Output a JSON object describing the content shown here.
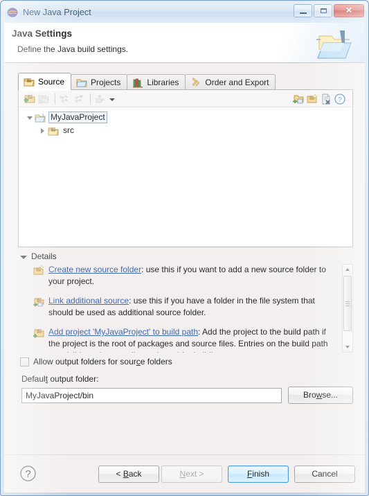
{
  "window": {
    "title": "New Java Project",
    "logo_icon": "eclipse-logo-icon",
    "controls": {
      "minimize": "minimize-icon",
      "maximize": "maximize-icon",
      "close": "✕"
    }
  },
  "banner": {
    "title": "Java Settings",
    "subtitle": "Define the Java build settings.",
    "icon": "java-project-folder-icon"
  },
  "tabs": [
    {
      "label": "Source",
      "icon": "source-folder-icon",
      "active": true
    },
    {
      "label": "Projects",
      "icon": "projects-folder-icon",
      "active": false
    },
    {
      "label": "Libraries",
      "icon": "libraries-books-icon",
      "active": false
    },
    {
      "label": "Order and Export",
      "icon": "order-export-arrows-icon",
      "active": false
    }
  ],
  "toolbar": {
    "left": [
      {
        "name": "add-folder-icon",
        "enabled": true
      },
      {
        "name": "link-source-icon",
        "enabled": false
      },
      {
        "name": "edit-entry-icon",
        "enabled": false
      },
      {
        "name": "remove-entry-icon",
        "enabled": false
      },
      {
        "name": "configure-filters-icon",
        "enabled": false
      }
    ],
    "dropdown_icon": "chevron-down-icon",
    "right": [
      {
        "name": "browse-folder-icon"
      },
      {
        "name": "new-source-folder-icon"
      },
      {
        "name": "clear-entries-icon"
      },
      {
        "name": "help-icon"
      }
    ]
  },
  "tree": {
    "root": {
      "label": "MyJavaProject",
      "icon": "project-folder-icon",
      "expanded": true,
      "selected": true
    },
    "children": [
      {
        "label": "src",
        "icon": "source-folder-icon",
        "expanded": false,
        "selected": false
      }
    ]
  },
  "details": {
    "header": "Details",
    "items": [
      {
        "icon": "new-source-folder-icon",
        "link": "Create new source folder",
        "rest": ": use this if you want to add a new source folder to your project."
      },
      {
        "icon": "link-source-icon",
        "link": "Link additional source",
        "rest": ": use this if you have a folder in the file system that should be used as additional source folder."
      },
      {
        "icon": "add-project-buildpath-icon",
        "link": "Add project 'MyJavaProject' to build path",
        "rest": ": Add the project to the build path if the project is the root of packages and source files. Entries on the build path are visible to the compiler and used for building."
      }
    ],
    "scrollbar": {
      "up_arrow": "scroll-up-icon",
      "down_arrow": "scroll-down-icon"
    }
  },
  "options": {
    "allow_output_folders": {
      "label_before": "Allow output folders for sour",
      "label_mnemonic": "c",
      "label_after": "e folders",
      "checked": false
    }
  },
  "output": {
    "label_before": "Defaul",
    "label_mnemonic": "t",
    "label_after": " output folder:",
    "value": "MyJavaProject/bin",
    "browse": {
      "before": "Bro",
      "mnemonic": "w",
      "after": "se..."
    }
  },
  "footer": {
    "help_icon": "help-icon",
    "buttons": [
      {
        "name": "back",
        "before": "< ",
        "mnemonic": "B",
        "after": "ack",
        "enabled": true,
        "default": false
      },
      {
        "name": "next",
        "before": "",
        "mnemonic": "N",
        "after": "ext >",
        "enabled": false,
        "default": false
      },
      {
        "name": "finish",
        "before": "",
        "mnemonic": "F",
        "after": "inish",
        "enabled": true,
        "default": true
      },
      {
        "name": "cancel",
        "before": "Cancel",
        "mnemonic": "",
        "after": "",
        "enabled": true,
        "default": false
      }
    ]
  },
  "colors": {
    "accent": "#1a4ea8",
    "dialog_bg": "#f1ecec",
    "panel_bg": "#ffffff",
    "close_red": "#c6372e",
    "default_button_border": "#2c8ad0"
  }
}
